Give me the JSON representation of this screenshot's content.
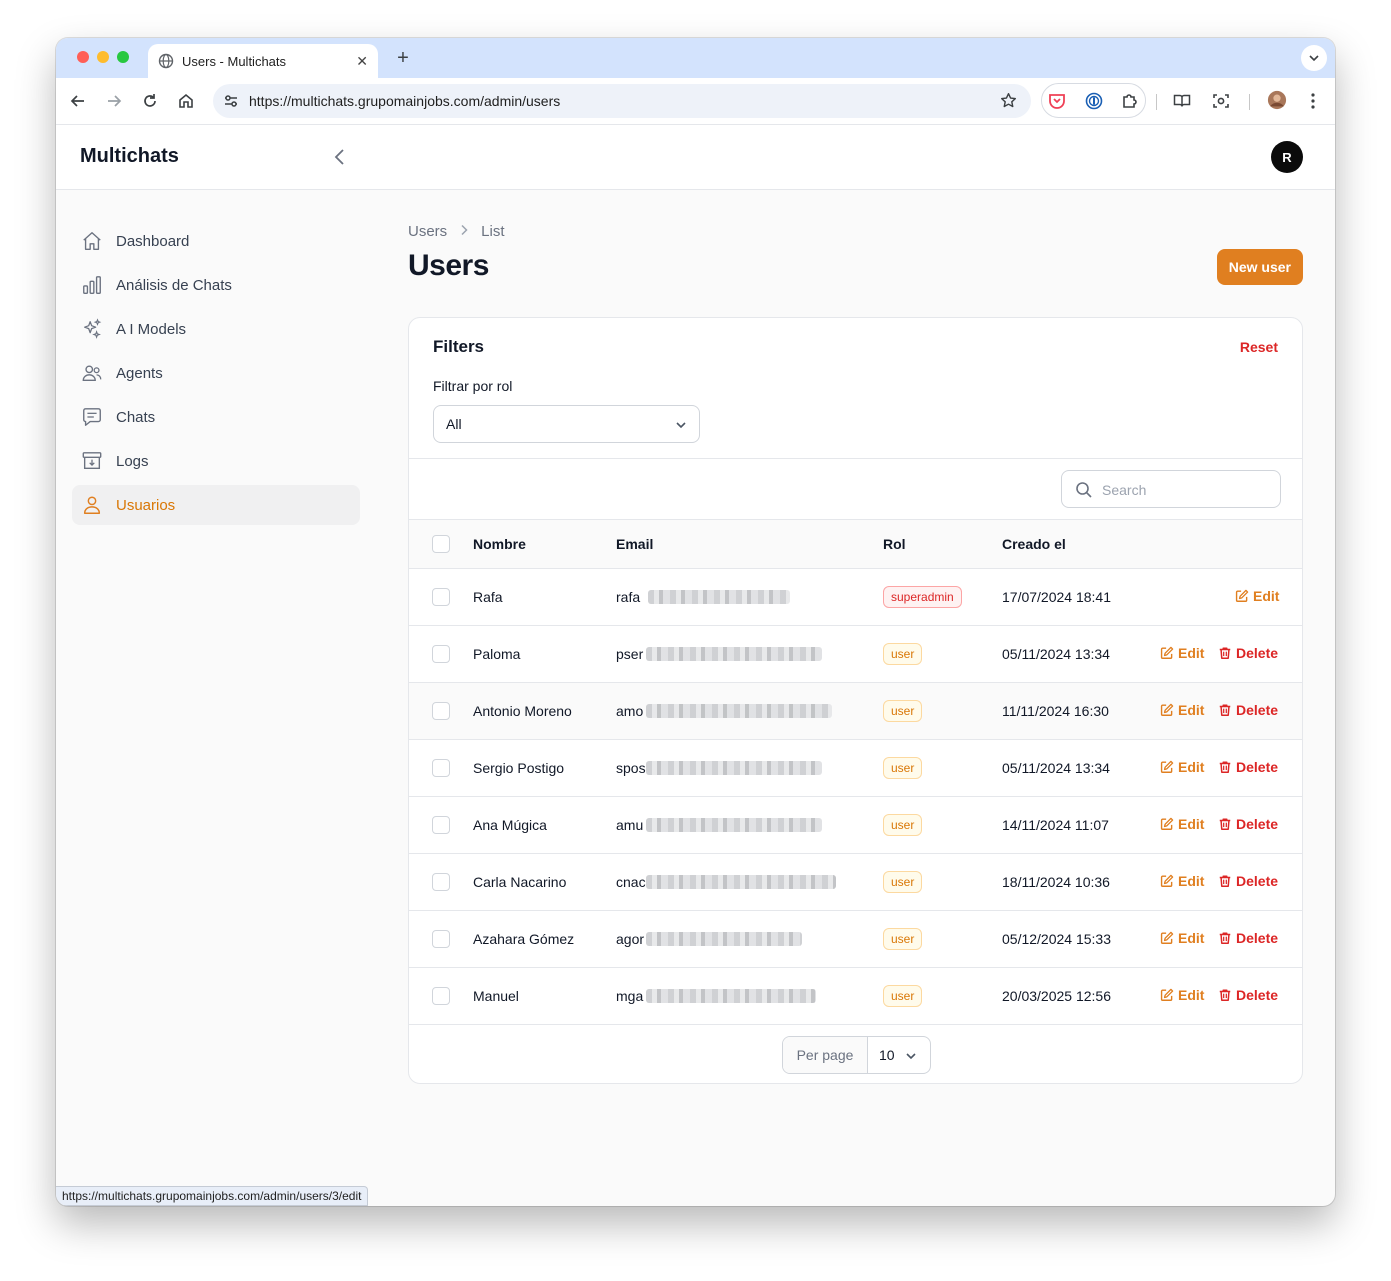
{
  "browser": {
    "tab_title": "Users - Multichats",
    "url": "https://multichats.grupomainjobs.com/admin/users",
    "status_url": "https://multichats.grupomainjobs.com/admin/users/3/edit",
    "traffic_colors": {
      "close": "#ff5f57",
      "minimize": "#febc2e",
      "maximize": "#28c840"
    }
  },
  "app": {
    "brand": "Multichats",
    "avatar_initial": "R",
    "accent_color": "#e07f20"
  },
  "sidebar": {
    "items": [
      {
        "label": "Dashboard",
        "icon": "home-icon"
      },
      {
        "label": "Análisis de Chats",
        "icon": "bar-chart-icon"
      },
      {
        "label": "A I Models",
        "icon": "sparkles-icon"
      },
      {
        "label": "Agents",
        "icon": "users-icon"
      },
      {
        "label": "Chats",
        "icon": "chat-icon"
      },
      {
        "label": "Logs",
        "icon": "archive-icon"
      },
      {
        "label": "Usuarios",
        "icon": "user-icon",
        "active": true
      }
    ]
  },
  "page": {
    "breadcrumb": [
      "Users",
      "List"
    ],
    "title": "Users",
    "new_button": "New user"
  },
  "filters": {
    "title": "Filters",
    "reset": "Reset",
    "role_label": "Filtrar por rol",
    "role_value": "All"
  },
  "search": {
    "placeholder": "Search"
  },
  "table": {
    "columns": [
      "Nombre",
      "Email",
      "Rol",
      "Creado el"
    ],
    "edit_label": "Edit",
    "delete_label": "Delete",
    "rows": [
      {
        "name": "Rafa",
        "email_prefix": "rafa",
        "role": "superadmin",
        "created": "17/07/2024 18:41",
        "deletable": false
      },
      {
        "name": "Paloma",
        "email_prefix": "pser",
        "role": "user",
        "created": "05/11/2024 13:34",
        "deletable": true
      },
      {
        "name": "Antonio Moreno",
        "email_prefix": "amo",
        "role": "user",
        "created": "11/11/2024 16:30",
        "deletable": true
      },
      {
        "name": "Sergio Postigo",
        "email_prefix": "spos",
        "role": "user",
        "created": "05/11/2024 13:34",
        "deletable": true
      },
      {
        "name": "Ana Múgica",
        "email_prefix": "amu",
        "role": "user",
        "created": "14/11/2024 11:07",
        "deletable": true
      },
      {
        "name": "Carla Nacarino",
        "email_prefix": "cnac",
        "role": "user",
        "created": "18/11/2024 10:36",
        "deletable": true
      },
      {
        "name": "Azahara Gómez",
        "email_prefix": "agor",
        "role": "user",
        "created": "05/12/2024 15:33",
        "deletable": true
      },
      {
        "name": "Manuel",
        "email_prefix": "mga",
        "role": "user",
        "created": "20/03/2025 12:56",
        "deletable": true
      }
    ]
  },
  "pagination": {
    "per_page_label": "Per page",
    "per_page_value": "10"
  }
}
